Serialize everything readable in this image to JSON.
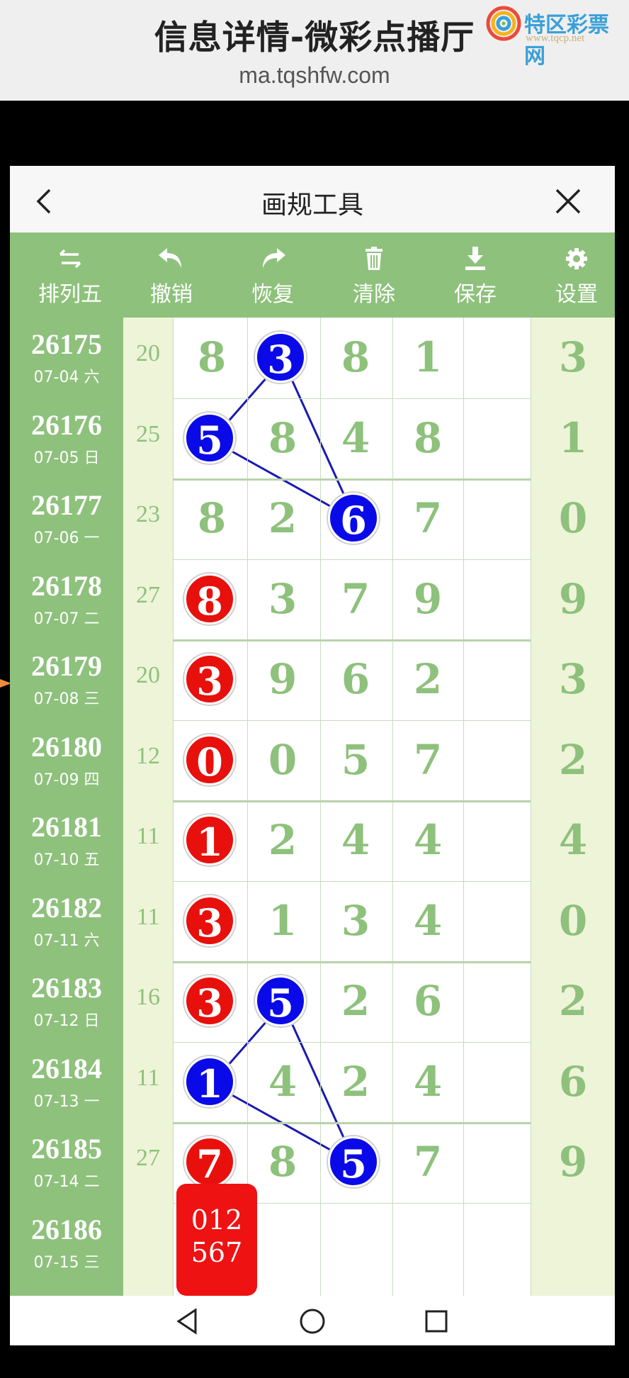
{
  "header": {
    "title": "信息详情-微彩点播厅",
    "url": "ma.tqshfw.com",
    "brand_name": "特区彩票网",
    "brand_url": "www.tqcp.net"
  },
  "app": {
    "title": "画规工具"
  },
  "toolbar": {
    "items": [
      {
        "label": "排列五",
        "icon": "swap-icon"
      },
      {
        "label": "撤销",
        "icon": "undo-icon"
      },
      {
        "label": "恢复",
        "icon": "redo-icon"
      },
      {
        "label": "清除",
        "icon": "trash-icon"
      },
      {
        "label": "保存",
        "icon": "download-icon"
      },
      {
        "label": "设置",
        "icon": "gear-icon"
      }
    ]
  },
  "rows": [
    {
      "issue": "26175",
      "date": "07-04 六",
      "sum": "20",
      "digits": [
        "8",
        "3",
        "8",
        "1",
        "3"
      ]
    },
    {
      "issue": "26176",
      "date": "07-05 日",
      "sum": "25",
      "digits": [
        "5",
        "8",
        "4",
        "8",
        "1"
      ]
    },
    {
      "issue": "26177",
      "date": "07-06 一",
      "sum": "23",
      "digits": [
        "8",
        "2",
        "6",
        "7",
        "0"
      ]
    },
    {
      "issue": "26178",
      "date": "07-07 二",
      "sum": "27",
      "digits": [
        "8",
        "3",
        "7",
        "9",
        "9"
      ]
    },
    {
      "issue": "26179",
      "date": "07-08 三",
      "sum": "20",
      "digits": [
        "3",
        "9",
        "6",
        "2",
        "3"
      ]
    },
    {
      "issue": "26180",
      "date": "07-09 四",
      "sum": "12",
      "digits": [
        "0",
        "0",
        "5",
        "7",
        "2"
      ]
    },
    {
      "issue": "26181",
      "date": "07-10 五",
      "sum": "11",
      "digits": [
        "1",
        "2",
        "4",
        "4",
        "4"
      ]
    },
    {
      "issue": "26182",
      "date": "07-11 六",
      "sum": "11",
      "digits": [
        "3",
        "1",
        "3",
        "4",
        "0"
      ]
    },
    {
      "issue": "26183",
      "date": "07-12 日",
      "sum": "16",
      "digits": [
        "3",
        "5",
        "2",
        "6",
        "2"
      ]
    },
    {
      "issue": "26184",
      "date": "07-13 一",
      "sum": "11",
      "digits": [
        "1",
        "4",
        "2",
        "4",
        "6"
      ]
    },
    {
      "issue": "26185",
      "date": "07-14 二",
      "sum": "27",
      "digits": [
        "7",
        "8",
        "5",
        "7",
        "9"
      ]
    },
    {
      "issue": "26186",
      "date": "07-15 三",
      "sum": "",
      "digits": [
        "",
        "",
        "",
        "",
        ""
      ]
    }
  ],
  "red_balls": [
    {
      "row": 3,
      "col": 0
    },
    {
      "row": 4,
      "col": 0
    },
    {
      "row": 5,
      "col": 0
    },
    {
      "row": 6,
      "col": 0
    },
    {
      "row": 7,
      "col": 0
    },
    {
      "row": 8,
      "col": 0
    },
    {
      "row": 10,
      "col": 0
    }
  ],
  "blue_balls": [
    {
      "row": 0,
      "col": 1
    },
    {
      "row": 1,
      "col": 0
    },
    {
      "row": 2,
      "col": 2
    },
    {
      "row": 8,
      "col": 1
    },
    {
      "row": 9,
      "col": 0
    },
    {
      "row": 10,
      "col": 2
    }
  ],
  "prediction": {
    "line1": "012",
    "line2": "567"
  },
  "colors": {
    "green": "#8ec17c",
    "red_ball": "#e8100c",
    "blue_ball": "#0a0ae8",
    "line": "#1a1ab0"
  }
}
